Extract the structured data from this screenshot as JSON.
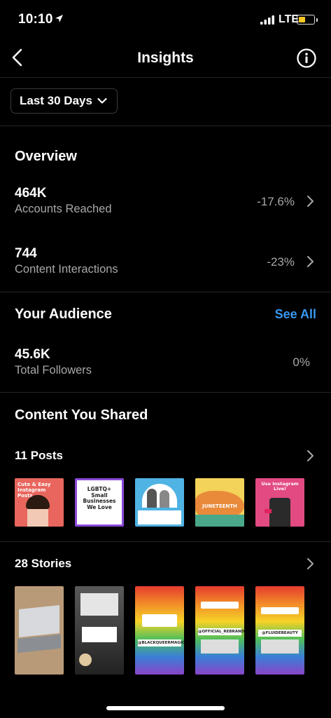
{
  "status_bar": {
    "time": "10:10",
    "network": "LTE",
    "battery_color": "#f6c824"
  },
  "header": {
    "title": "Insights",
    "back_icon": "chevron-left-icon",
    "info_icon": "info-circle-icon"
  },
  "filter": {
    "label": "Last 30 Days"
  },
  "overview": {
    "title": "Overview",
    "metrics": [
      {
        "value": "464K",
        "label": "Accounts Reached",
        "delta": "-17.6%"
      },
      {
        "value": "744",
        "label": "Content Interactions",
        "delta": "-23%"
      }
    ]
  },
  "audience": {
    "title": "Your Audience",
    "see_all": "See All",
    "followers": {
      "value": "45.6K",
      "label": "Total Followers",
      "delta": "0%"
    }
  },
  "content": {
    "title": "Content You Shared",
    "posts": {
      "label": "11 Posts",
      "thumbnails": [
        {
          "caption": "Cute & Easy Instagram Posts",
          "bg": "#e8665d"
        },
        {
          "caption": "LGBTQ+ Small Businesses We Love",
          "bg": "#ffffff"
        },
        {
          "caption": "",
          "bg": "#4fb3e3"
        },
        {
          "caption": "JUNETEENTH",
          "bg": "#f3d35a"
        },
        {
          "caption": "Use Instagram Live!",
          "bg": "#e34a82"
        }
      ]
    },
    "stories": {
      "label": "28 Stories",
      "thumbnails": [
        {
          "caption": "",
          "bg": "#b99a78"
        },
        {
          "caption": "",
          "bg": "#3d3d3d"
        },
        {
          "caption": "@BLACKQUEERMAGIC",
          "bg": "rainbow"
        },
        {
          "caption": "@OFFICIAL_REBRAND",
          "bg": "rainbow"
        },
        {
          "caption": "@FLUIDEBEAUTY",
          "bg": "rainbow"
        }
      ]
    }
  },
  "colors": {
    "accent": "#3897f0",
    "secondary_text": "#a8a8a8",
    "divider": "#262626"
  }
}
